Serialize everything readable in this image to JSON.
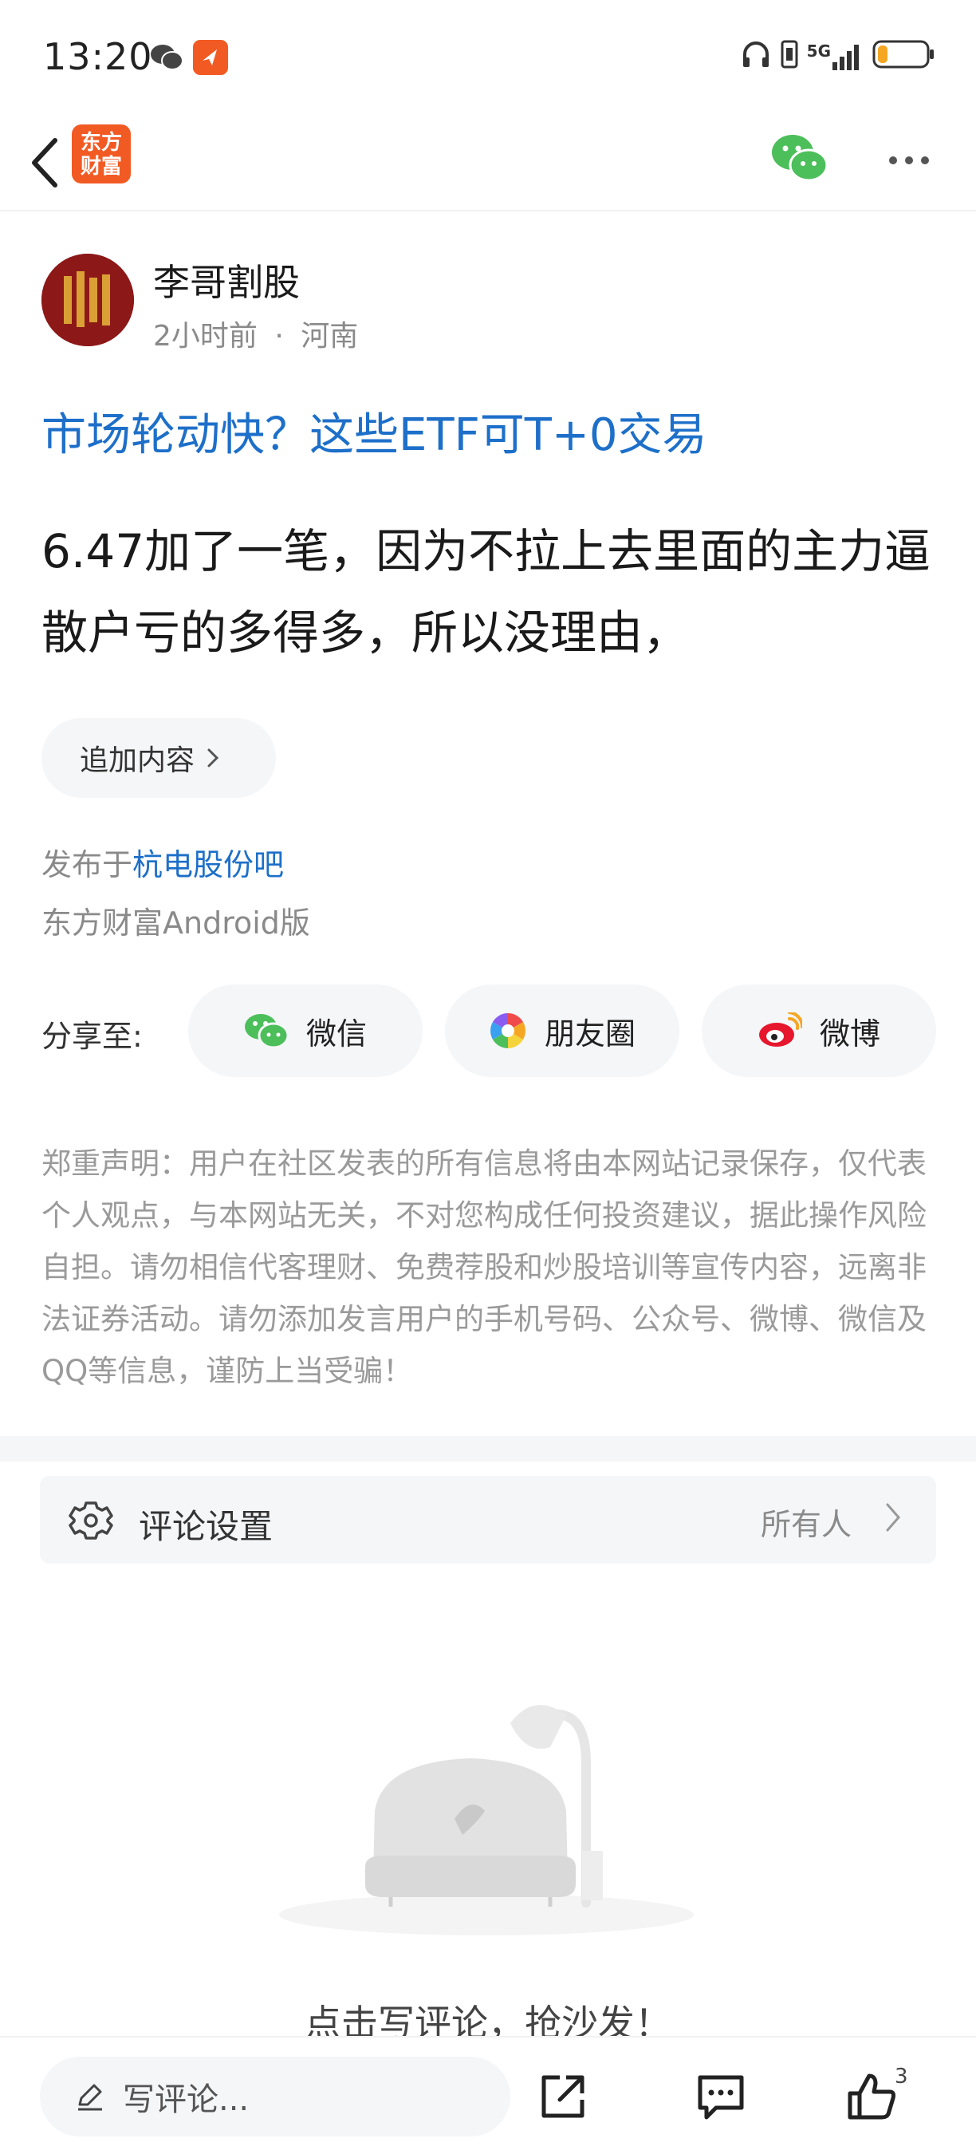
{
  "status_bar": {
    "time": "13:20",
    "network_label": "5G",
    "icons": [
      "wechat-icon",
      "app-notification-icon",
      "headphones-icon",
      "vibrate-icon",
      "signal-icon",
      "battery-icon"
    ],
    "battery_level": 0.2,
    "battery_color": "#f5a623"
  },
  "nav": {
    "logo_text_line1": "东方",
    "logo_text_line2": "财富",
    "logo_color": "#f25a24"
  },
  "author": {
    "name": "李哥割股",
    "time_ago": "2小时前",
    "separator": "·",
    "location": "河南"
  },
  "post": {
    "title": "市场轮动快？这些ETF可T+0交易",
    "title_color": "#1d6fc9",
    "body": "6.47加了一笔，因为不拉上去里面的主力逼散户亏的多得多，所以没理由，",
    "append_label": "追加内容",
    "published_prefix": "发布于",
    "bar_name": "杭电股份吧",
    "client": "东方财富Android版"
  },
  "share": {
    "label": "分享至:",
    "wechat": "微信",
    "moments": "朋友圈",
    "weibo": "微博"
  },
  "disclaimer": "郑重声明：用户在社区发表的所有信息将由本网站记录保存，仅代表个人观点，与本网站无关，不对您构成任何投资建议，据此操作风险自担。请勿相信代客理财、免费荐股和炒股培训等宣传内容，远离非法证券活动。请勿添加发言用户的手机号码、公众号、微博、微信及QQ等信息，谨防上当受骗！",
  "comment_settings": {
    "label": "评论设置",
    "value": "所有人"
  },
  "empty_state": {
    "text": "点击写评论，抢沙发！"
  },
  "bottom_bar": {
    "comment_placeholder": "写评论...",
    "like_count": "3"
  }
}
